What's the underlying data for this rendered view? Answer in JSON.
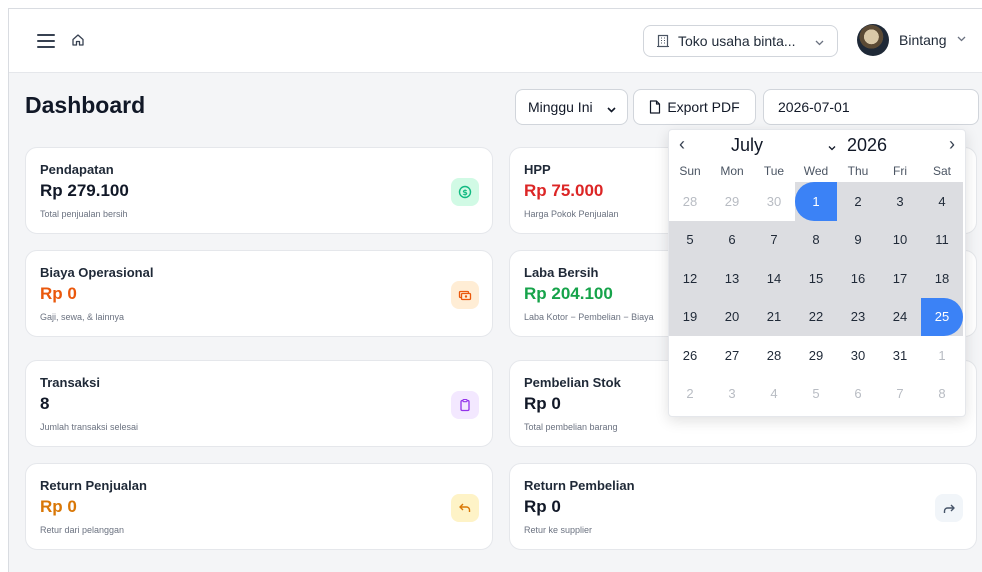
{
  "topbar": {
    "store_name": "Toko usaha binta...",
    "user_name": "Bintang"
  },
  "header": {
    "title": "Dashboard",
    "period_selected": "Minggu Ini",
    "export_label": "Export PDF",
    "date_value": "2026-07-01"
  },
  "cards": [
    {
      "label": "Pendapatan",
      "value": "Rp 279.100",
      "desc": "Total penjualan bersih",
      "value_color": "#111827",
      "icon": "dollar-icon",
      "icon_bg": "#d1fae5",
      "icon_color": "#10b981"
    },
    {
      "label": "HPP",
      "value": "Rp 75.000",
      "desc": "Harga Pokok Penjualan",
      "value_color": "#dc2626"
    },
    {
      "label": "Biaya Operasional",
      "value": "Rp 0",
      "desc": "Gaji, sewa, & lainnya",
      "value_color": "#ea580c",
      "icon": "cash-icon",
      "icon_bg": "#ffedd5",
      "icon_color": "#ea580c"
    },
    {
      "label": "Laba Bersih",
      "value": "Rp 204.100",
      "desc": "Laba Kotor − Pembelian − Biaya",
      "value_color": "#16a34a"
    },
    {
      "label": "Transaksi",
      "value": "8",
      "desc": "Jumlah transaksi selesai",
      "value_color": "#111827",
      "icon": "clipboard-icon",
      "icon_bg": "#f3e8ff",
      "icon_color": "#9333ea"
    },
    {
      "label": "Pembelian Stok",
      "value": "Rp 0",
      "desc": "Total pembelian barang",
      "value_color": "#111827"
    },
    {
      "label": "Return Penjualan",
      "value": "Rp 0",
      "desc": "Retur dari pelanggan",
      "value_color": "#d97706",
      "icon": "undo-icon",
      "icon_bg": "#fef3c7",
      "icon_color": "#d97706"
    },
    {
      "label": "Return Pembelian",
      "value": "Rp 0",
      "desc": "Retur ke supplier",
      "value_color": "#111827",
      "icon": "redo-icon",
      "icon_bg": "#f1f5f9",
      "icon_color": "#475569"
    }
  ],
  "calendar": {
    "month": "July",
    "year": "2026",
    "weekdays": [
      "Sun",
      "Mon",
      "Tue",
      "Wed",
      "Thu",
      "Fri",
      "Sat"
    ],
    "weeks": [
      [
        "28",
        "29",
        "30",
        "1",
        "2",
        "3",
        "4"
      ],
      [
        "5",
        "6",
        "7",
        "8",
        "9",
        "10",
        "11"
      ],
      [
        "12",
        "13",
        "14",
        "15",
        "16",
        "17",
        "18"
      ],
      [
        "19",
        "20",
        "21",
        "22",
        "23",
        "24",
        "25"
      ],
      [
        "26",
        "27",
        "28",
        "29",
        "30",
        "31",
        "1"
      ],
      [
        "2",
        "3",
        "4",
        "5",
        "6",
        "7",
        "8"
      ]
    ],
    "range_start": "2026-07-01",
    "range_end": "2026-07-25",
    "accent_color": "#3b82f6"
  }
}
